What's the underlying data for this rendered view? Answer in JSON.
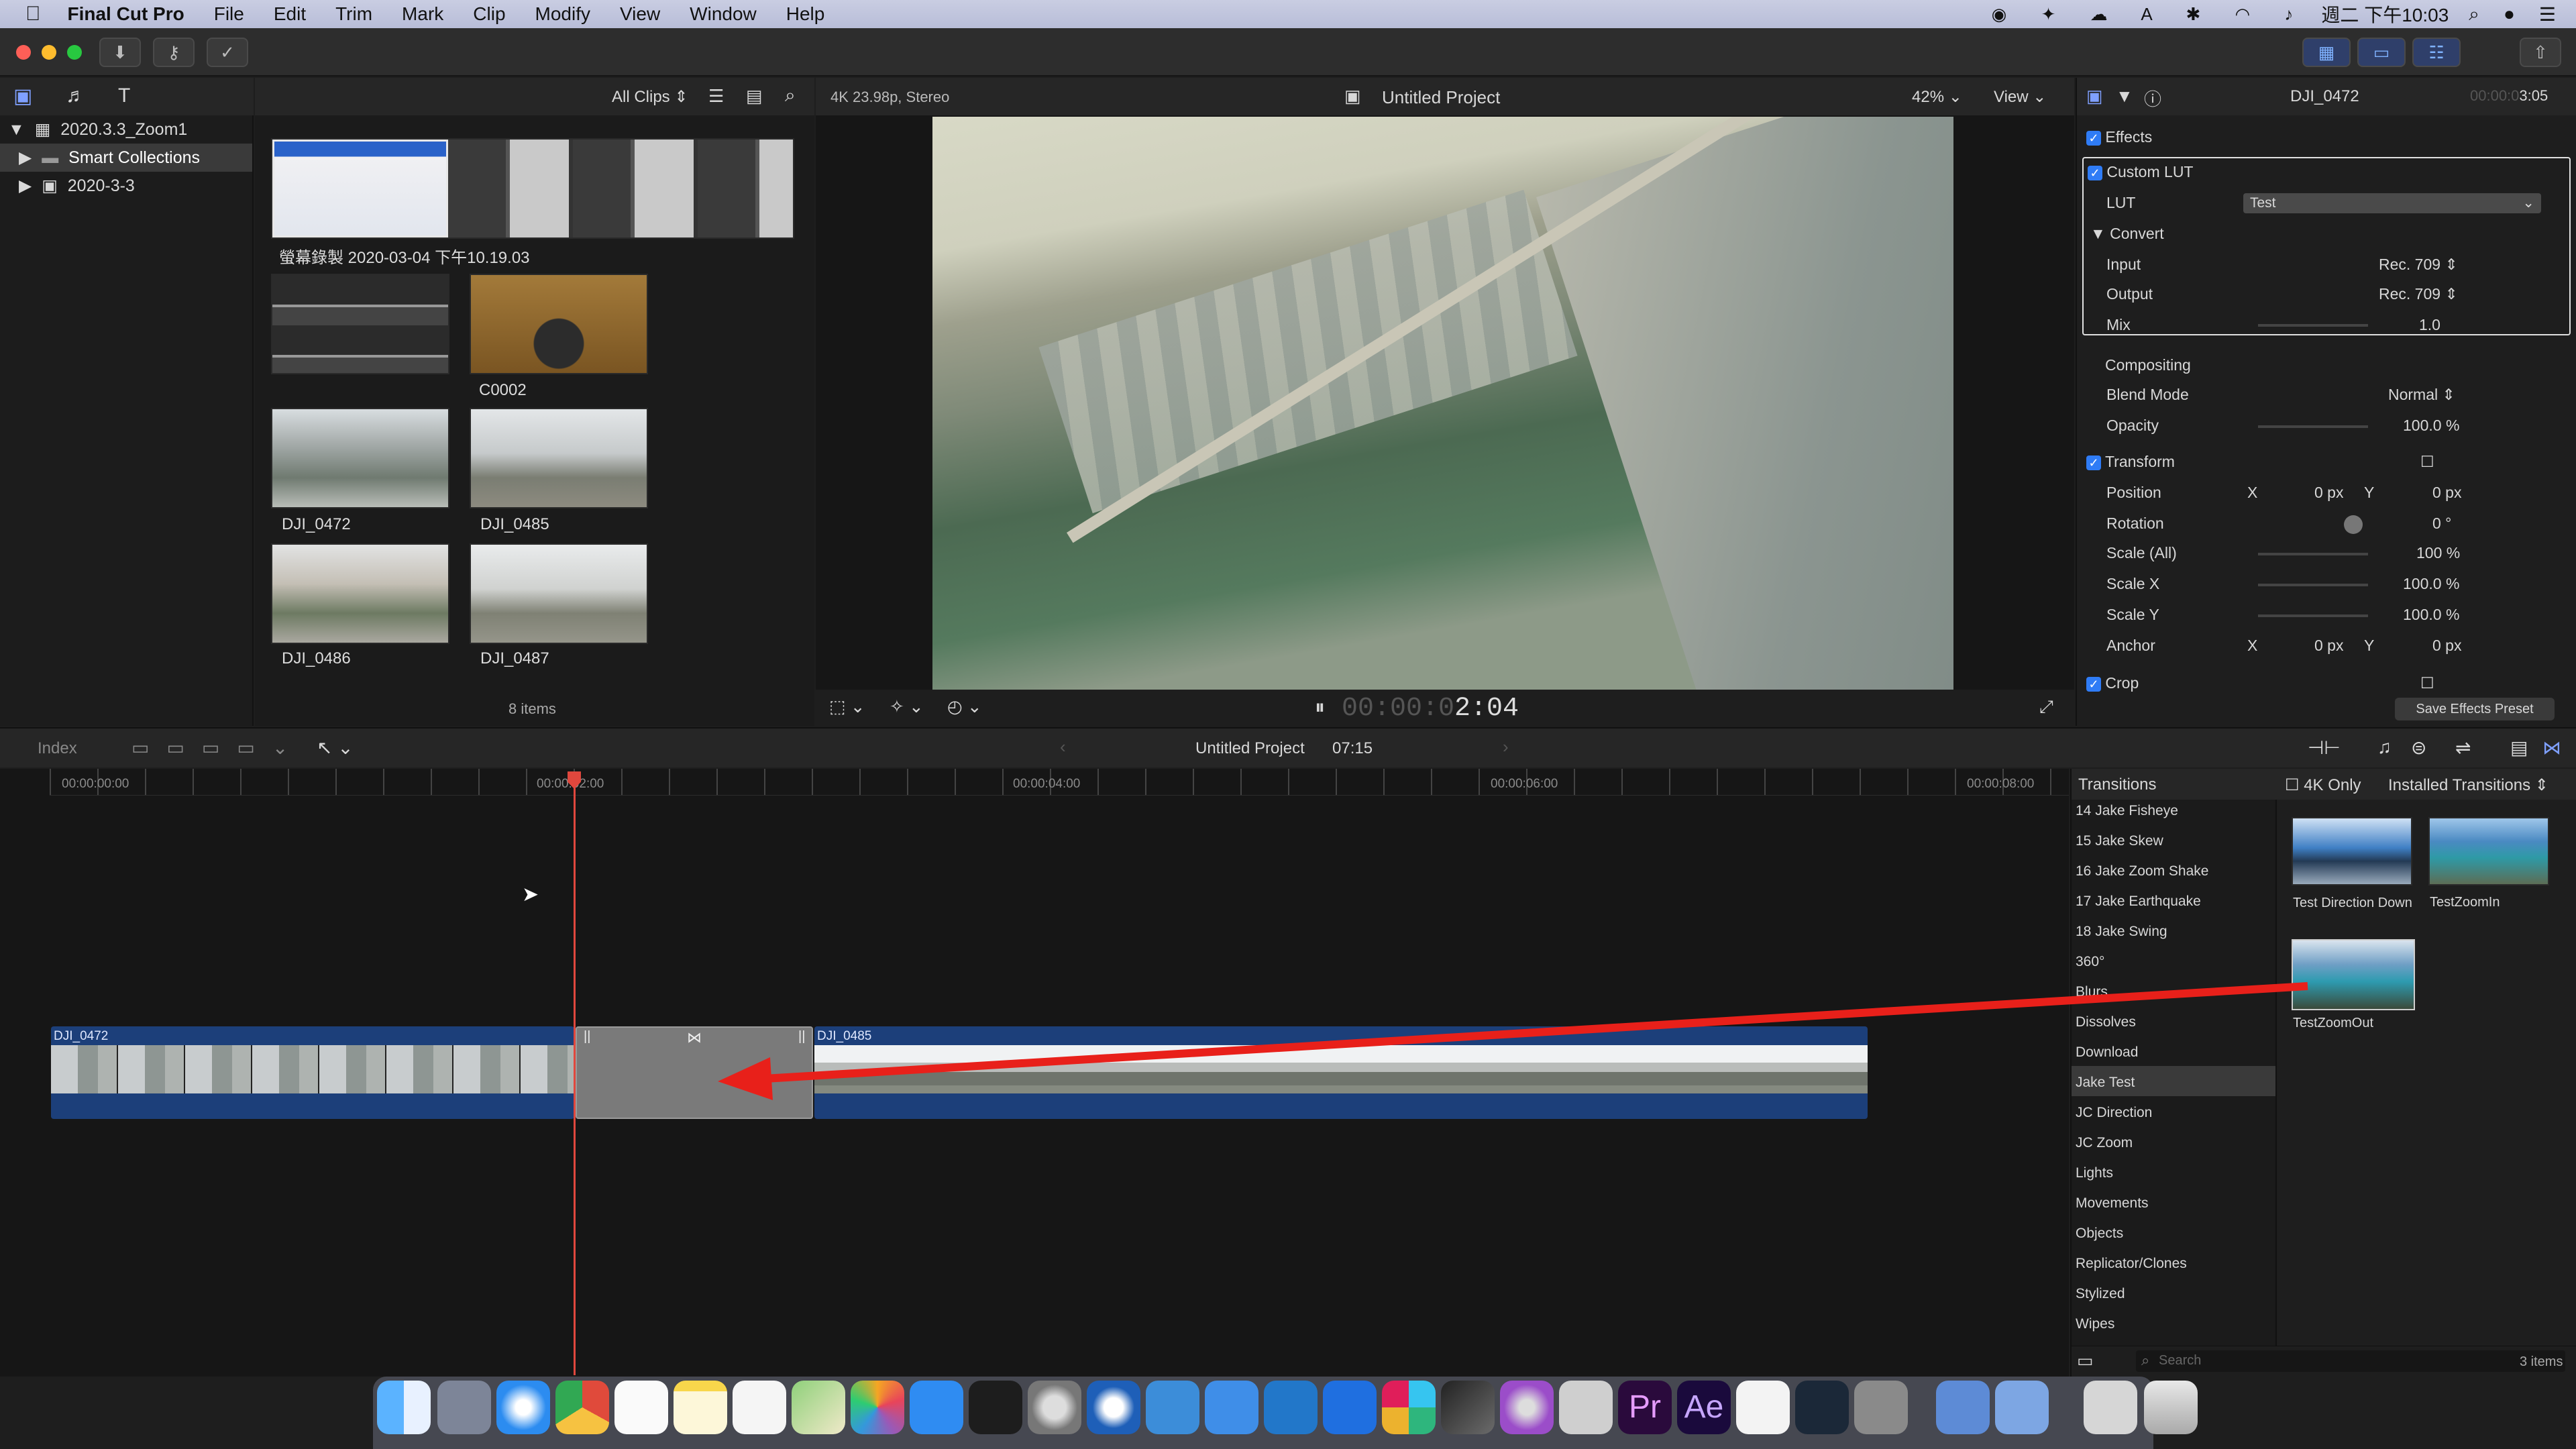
{
  "menubar": {
    "app": "Final Cut Pro",
    "items": [
      "File",
      "Edit",
      "Trim",
      "Mark",
      "Clip",
      "Modify",
      "View",
      "Window",
      "Help"
    ],
    "clock": "週二 下午10:03"
  },
  "sidebar": {
    "library": "2020.3.3_Zoom1",
    "items": [
      {
        "label": "Smart Collections"
      },
      {
        "label": "2020-3-3"
      }
    ]
  },
  "browser": {
    "filter": "All Clips",
    "top_clip_label": "螢幕錄製 2020-03-04 下午10.19.03",
    "clips": [
      "C0002",
      "DJI_0472",
      "DJI_0485",
      "DJI_0486",
      "DJI_0487"
    ],
    "count": "8 items"
  },
  "viewer": {
    "format": "4K 23.98p, Stereo",
    "title": "Untitled Project",
    "zoom": "42%",
    "view_menu": "View",
    "timecode_dim": "00:00:0",
    "timecode": "2:04"
  },
  "inspector": {
    "clip": "DJI_0472",
    "duration_dim": "00:00:0",
    "duration": "3:05",
    "effects": "Effects",
    "custom_lut": "Custom LUT",
    "lut_label": "LUT",
    "lut_value": "Test",
    "convert": "Convert",
    "input_label": "Input",
    "input_value": "Rec. 709",
    "output_label": "Output",
    "output_value": "Rec. 709",
    "mix_label": "Mix",
    "mix_value": "1.0",
    "compositing": "Compositing",
    "blend_label": "Blend Mode",
    "blend_value": "Normal",
    "opacity_label": "Opacity",
    "opacity_value": "100.0 %",
    "transform": "Transform",
    "position_label": "Position",
    "x": "X",
    "y": "Y",
    "pos_x": "0 px",
    "pos_y": "0 px",
    "rotation_label": "Rotation",
    "rotation_value": "0 °",
    "scale_all_label": "Scale (All)",
    "scale_all_value": "100 %",
    "scale_x_label": "Scale X",
    "scale_x_value": "100.0 %",
    "scale_y_label": "Scale Y",
    "scale_y_value": "100.0 %",
    "anchor_label": "Anchor",
    "anchor_x": "0 px",
    "anchor_y": "0 px",
    "crop": "Crop",
    "save_preset": "Save Effects Preset"
  },
  "timeline": {
    "index": "Index",
    "project": "Untitled Project",
    "duration": "07:15",
    "ticks": [
      "00:00:00:00",
      "00:00:02:00",
      "00:00:04:00",
      "00:00:06:00",
      "00:00:08:00"
    ],
    "clip1": "DJI_0472",
    "clip2": "DJI_0485"
  },
  "transitions": {
    "title": "Transitions",
    "filter": "4K Only",
    "installed": "Installed Transitions",
    "items": [
      "14 Jake Fisheye",
      "15 Jake Skew",
      "16 Jake Zoom Shake",
      "17 Jake Earthquake",
      "18 Jake Swing",
      "360°",
      "Blurs",
      "Dissolves",
      "Download",
      "Jake Test",
      "JC Direction",
      "JC Zoom",
      "Lights",
      "Movements",
      "Objects",
      "Replicator/Clones",
      "Stylized",
      "Wipes"
    ],
    "selected": "Jake Test",
    "thumbs": [
      "Test Direction Down",
      "TestZoomIn",
      "TestZoomOut"
    ],
    "search_placeholder": "Search",
    "count": "3 items"
  },
  "colors": {
    "accent": "#2f7cf6",
    "playhead": "#e0473d",
    "clip_blue": "#1c3f7a",
    "arrow": "#e8201a"
  }
}
